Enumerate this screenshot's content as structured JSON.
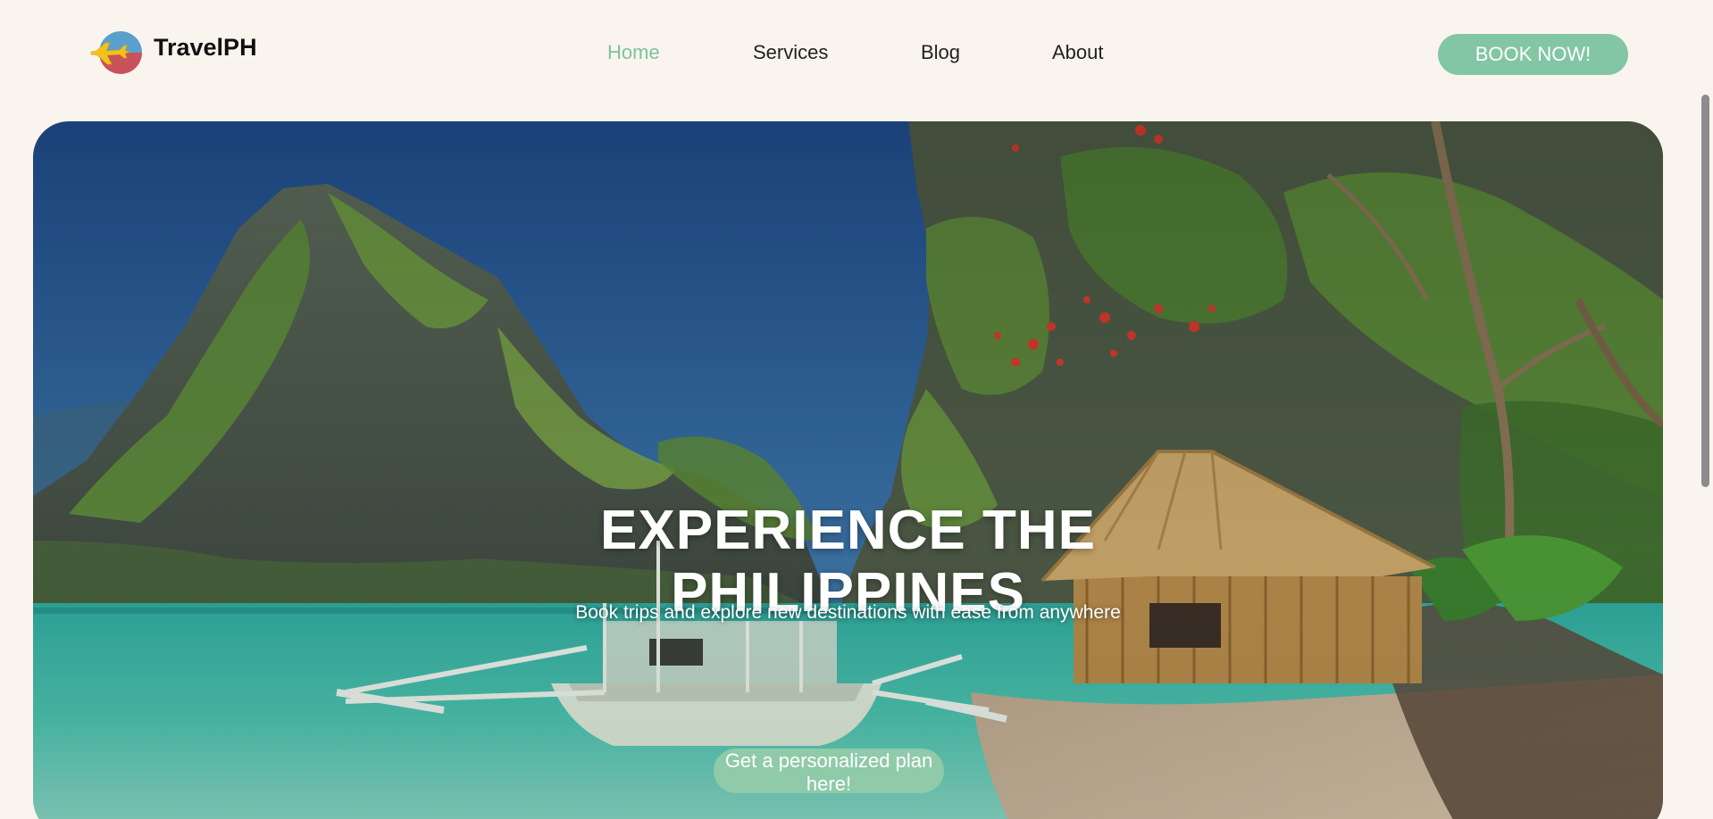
{
  "brand": {
    "name": "TravelPH",
    "logo_icon": "airplane-globe-logo-icon"
  },
  "nav": {
    "items": [
      {
        "label": "Home",
        "active": true
      },
      {
        "label": "Services",
        "active": false
      },
      {
        "label": "Blog",
        "active": false
      },
      {
        "label": "About",
        "active": false
      }
    ],
    "book_button": "BOOK NOW!"
  },
  "hero": {
    "title": "EXPERIENCE THE\nPHILIPPINES",
    "subtitle": "Book trips and explore new destinations with ease from anywhere",
    "cta": "Get a personalized plan here!",
    "image": "tropical-lagoon-with-limestone-cliffs-outrigger-boat-and-nipa-hut"
  },
  "colors": {
    "background": "#faf4ee",
    "accent": "#83c6a3",
    "active_nav": "#7cc39f",
    "text": "#222222"
  }
}
